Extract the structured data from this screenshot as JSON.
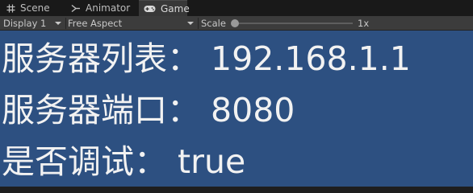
{
  "tabs": [
    {
      "label": "Scene",
      "icon": "grid-icon"
    },
    {
      "label": "Animator",
      "icon": "animator-icon"
    },
    {
      "label": "Game",
      "icon": "gamepad-icon",
      "active": true
    }
  ],
  "toolbar": {
    "display": "Display 1",
    "aspect": "Free Aspect",
    "scale_label": "Scale",
    "scale_value": "1x"
  },
  "game": {
    "lines": [
      {
        "label": "服务器列表",
        "sep": "：",
        "value": "192.168.1.1"
      },
      {
        "label": "服务器端口",
        "sep": "：",
        "value": "8080"
      },
      {
        "label": "是否调试",
        "sep": "：",
        "value": "true"
      }
    ]
  },
  "colors": {
    "tabbar": "#191919",
    "toolbar": "#3c3c3c",
    "game_background": "#2d5081",
    "text": "#f2f2f2"
  }
}
